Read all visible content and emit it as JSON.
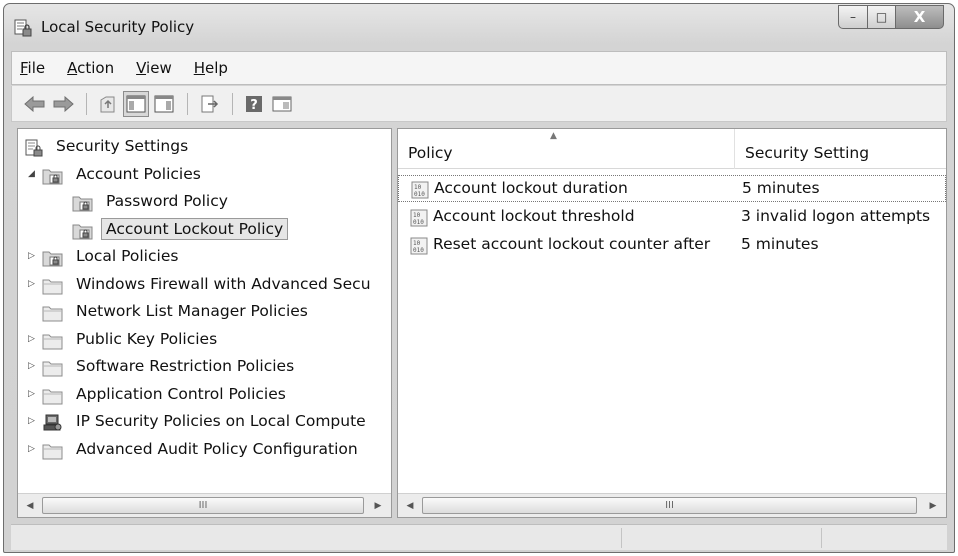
{
  "window": {
    "title": "Local Security Policy",
    "buttons": {
      "minimize": "–",
      "maximize": "□",
      "close": "X"
    }
  },
  "menu": [
    {
      "label": "File",
      "accel": "F",
      "rest": "ile"
    },
    {
      "label": "Action",
      "accel": "A",
      "rest": "ction"
    },
    {
      "label": "View",
      "accel": "V",
      "rest": "iew"
    },
    {
      "label": "Help",
      "accel": "H",
      "rest": "elp"
    }
  ],
  "toolbar": {
    "icons": [
      "back-icon",
      "forward-icon",
      "up-folder-icon",
      "show-hide-console-tree-icon",
      "export-list-icon",
      "help-icon",
      "properties-icon"
    ]
  },
  "tree": {
    "items": [
      {
        "label": "Security Settings",
        "expander": "",
        "icon": "security-settings-icon",
        "level": 0
      },
      {
        "label": "Account Policies",
        "expander": "◢",
        "icon": "policy-folder-icon",
        "level": 1
      },
      {
        "label": "Password Policy",
        "expander": "",
        "icon": "policy-folder-icon",
        "level": 2
      },
      {
        "label": "Account Lockout Policy",
        "expander": "",
        "icon": "policy-folder-icon",
        "level": 2,
        "selected": true
      },
      {
        "label": "Local Policies",
        "expander": "▷",
        "icon": "policy-folder-icon",
        "level": 1
      },
      {
        "label": "Windows Firewall with Advanced Secu",
        "expander": "▷",
        "icon": "folder-icon",
        "level": 1
      },
      {
        "label": "Network List Manager Policies",
        "expander": "",
        "icon": "folder-icon",
        "level": 1
      },
      {
        "label": "Public Key Policies",
        "expander": "▷",
        "icon": "folder-icon",
        "level": 1
      },
      {
        "label": "Software Restriction Policies",
        "expander": "▷",
        "icon": "folder-icon",
        "level": 1
      },
      {
        "label": "Application Control Policies",
        "expander": "▷",
        "icon": "folder-icon",
        "level": 1
      },
      {
        "label": "IP Security Policies on Local Compute",
        "expander": "▷",
        "icon": "ip-security-icon",
        "level": 1
      },
      {
        "label": "Advanced Audit Policy Configuration",
        "expander": "▷",
        "icon": "folder-icon",
        "level": 1
      }
    ]
  },
  "list": {
    "columns": {
      "policy": "Policy",
      "setting": "Security Setting"
    },
    "rows": [
      {
        "policy": "Account lockout duration",
        "setting": "5 minutes"
      },
      {
        "policy": "Account lockout threshold",
        "setting": "3 invalid logon attempts"
      },
      {
        "policy": "Reset account lockout counter after",
        "setting": "5 minutes"
      }
    ]
  },
  "scrollbars": {
    "left_arrow": "◀",
    "right_arrow": "▶",
    "grip": "III"
  }
}
